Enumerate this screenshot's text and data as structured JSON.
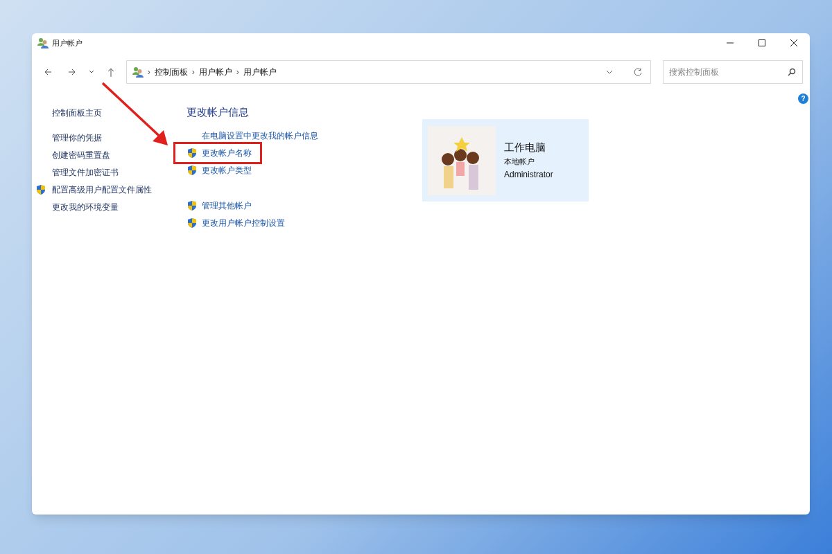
{
  "window": {
    "title": "用户帐户"
  },
  "address_bar": {
    "breadcrumbs": [
      {
        "separator": "›",
        "text": "控制面板"
      },
      {
        "separator": "›",
        "text": "用户帐户"
      },
      {
        "separator": "›",
        "text": "用户帐户"
      }
    ]
  },
  "help": {
    "text": "?"
  },
  "search": {
    "placeholder": "搜索控制面板"
  },
  "sidebar": {
    "items": [
      {
        "text": "控制面板主页",
        "shield": false
      },
      {
        "text": "管理你的凭据",
        "shield": false
      },
      {
        "text": "创建密码重置盘",
        "shield": false
      },
      {
        "text": "管理文件加密证书",
        "shield": false
      },
      {
        "text": "配置高级用户配置文件属性",
        "shield": true
      },
      {
        "text": "更改我的环境变量",
        "shield": false
      }
    ]
  },
  "main": {
    "heading": "更改帐户信息",
    "groups": [
      [
        {
          "text": "在电脑设置中更改我的帐户信息",
          "shield": false,
          "highlighted": false
        },
        {
          "text": "更改帐户名称",
          "shield": true,
          "highlighted": true
        },
        {
          "text": "更改帐户类型",
          "shield": true,
          "highlighted": false
        }
      ],
      [
        {
          "text": "管理其他帐户",
          "shield": true,
          "highlighted": false
        },
        {
          "text": "更改用户帐户控制设置",
          "shield": true,
          "highlighted": false
        }
      ]
    ]
  },
  "account": {
    "name": "工作电脑",
    "type": "本地帐户",
    "role": "Administrator"
  }
}
